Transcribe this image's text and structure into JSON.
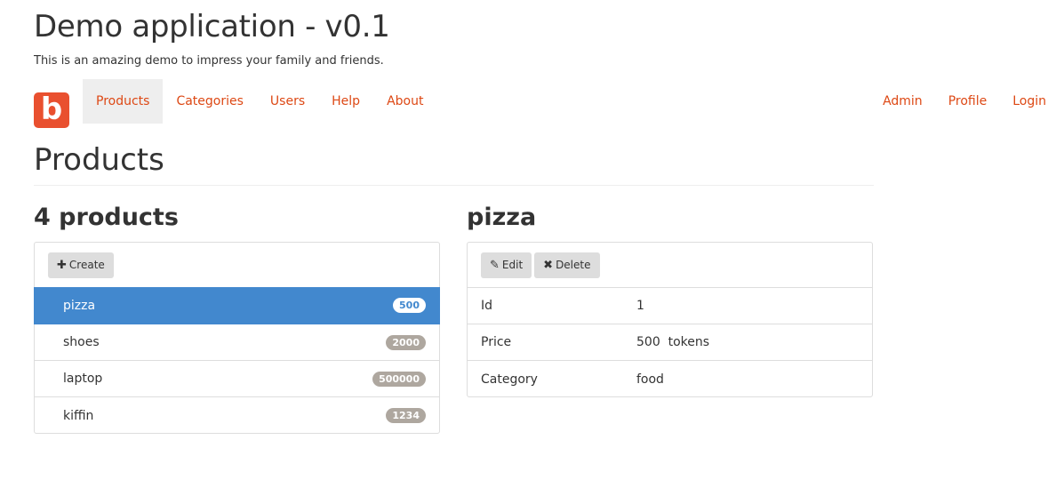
{
  "header": {
    "title": "Demo application - v0.1",
    "subtitle": "This is an amazing demo to impress your family and friends."
  },
  "navbar": {
    "brand_letter": "b",
    "brand_color": "#e9502f",
    "left_items": [
      {
        "label": "Products",
        "active": true
      },
      {
        "label": "Categories",
        "active": false
      },
      {
        "label": "Users",
        "active": false
      },
      {
        "label": "Help",
        "active": false
      },
      {
        "label": "About",
        "active": false
      }
    ],
    "right_items": [
      {
        "label": "Admin"
      },
      {
        "label": "Profile"
      },
      {
        "label": "Login"
      }
    ]
  },
  "page": {
    "title": "Products"
  },
  "product_list": {
    "title": "4 products",
    "create_label": "Create",
    "create_icon": "plus-icon",
    "items": [
      {
        "name": "pizza",
        "badge": "500",
        "active": true
      },
      {
        "name": "shoes",
        "badge": "2000",
        "active": false
      },
      {
        "name": "laptop",
        "badge": "500000",
        "active": false
      },
      {
        "name": "kiffin",
        "badge": "1234",
        "active": false
      }
    ]
  },
  "product_detail": {
    "title": "pizza",
    "edit_label": "Edit",
    "edit_icon": "edit-icon",
    "delete_label": "Delete",
    "delete_icon": "close-icon",
    "fields": [
      {
        "label": "Id",
        "value": "1"
      },
      {
        "label": "Price",
        "value": "500  tokens"
      },
      {
        "label": "Category",
        "value": "food"
      }
    ]
  },
  "colors": {
    "link": "#dd4814",
    "active_row": "#4288ce",
    "badge": "#aea79f"
  }
}
